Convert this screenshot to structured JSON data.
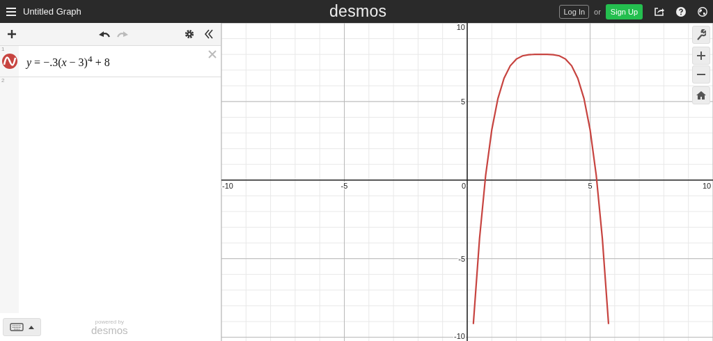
{
  "top_bar": {
    "title": "Untitled Graph",
    "logo": "desmos",
    "login": "Log In",
    "or": "or",
    "signup": "Sign Up"
  },
  "expressions": [
    {
      "index": "1",
      "latex": "*y* = −.3(*x* − 3)$^{4}$ + 8",
      "color": "#c74440"
    },
    {
      "index": "2"
    }
  ],
  "footer": {
    "powered_by": "powered by",
    "brand": "desmos"
  },
  "graph": {
    "chart_data": {
      "type": "line",
      "xlim": [
        -10,
        10
      ],
      "ylim": [
        -10.24,
        10
      ],
      "grid": true,
      "xticks": [
        -10,
        -5,
        0,
        5,
        10
      ],
      "yticks": [
        -10,
        -5,
        5,
        10
      ],
      "x": [
        0.25,
        0.5,
        0.75,
        1,
        1.25,
        1.5,
        1.75,
        2,
        2.25,
        2.5,
        2.75,
        3,
        3.25,
        3.5,
        3.75,
        4,
        4.25,
        4.5,
        4.75,
        5,
        5.25,
        5.5,
        5.75
      ],
      "series": [
        {
          "color": "#c74440",
          "values": [
            -9.16,
            -3.72,
            0.31,
            3.2,
            5.19,
            6.48,
            7.27,
            7.7,
            7.91,
            7.98,
            8.0,
            8,
            8.0,
            7.98,
            7.91,
            7.7,
            7.27,
            6.48,
            5.19,
            3.2,
            0.31,
            -3.72,
            -9.16
          ]
        }
      ]
    }
  }
}
